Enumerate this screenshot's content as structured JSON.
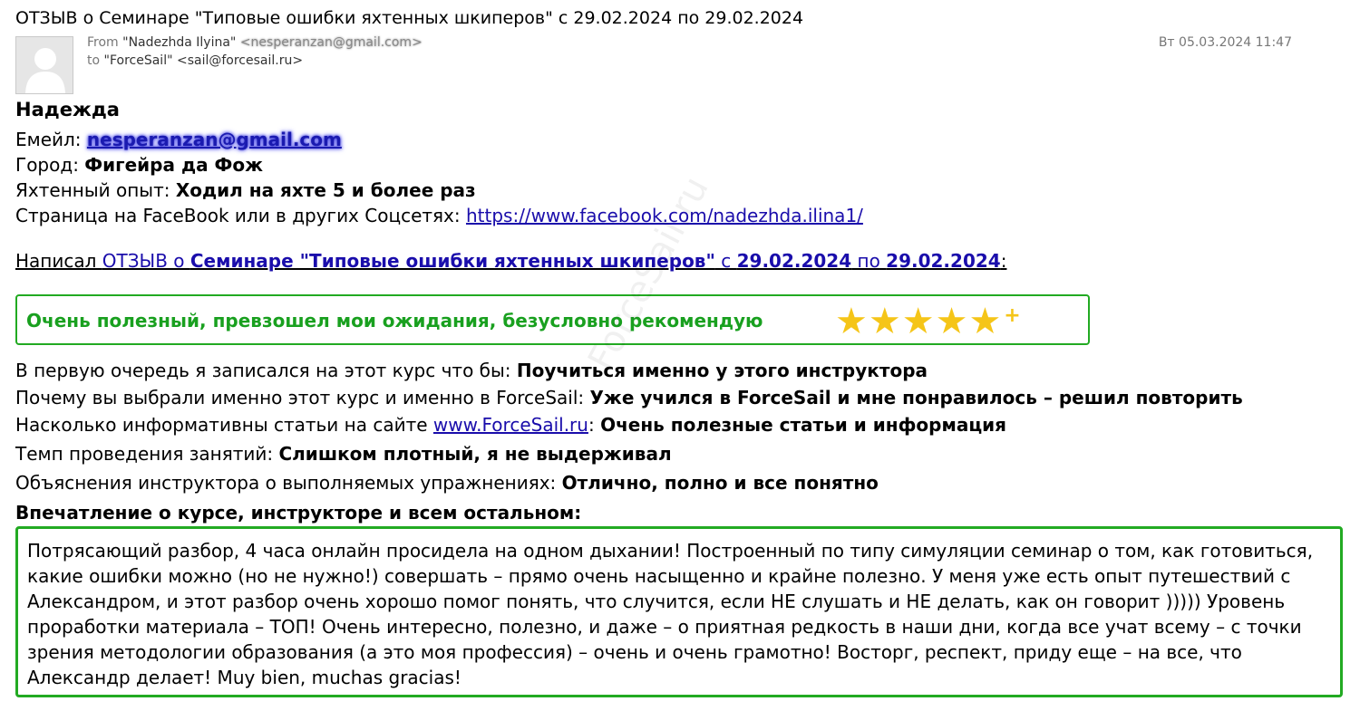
{
  "subject": "ОТЗЫВ о Семинаре \"Типовые ошибки яхтенных шкиперов\" с 29.02.2024 по 29.02.2024",
  "header": {
    "from_label": "From",
    "from_name": "\"Nadezhda Ilyina\"",
    "from_email": "<nesperanzan@gmail.com>",
    "to_label": "to",
    "to_value": "\"ForceSail\" <sail@forcesail.ru>",
    "date": "Вт 05.03.2024 11:47"
  },
  "body": {
    "name": "Надежда",
    "email_label": "Емейл: ",
    "email_value": "nesperanzan@gmail.com",
    "city_label": "Город: ",
    "city_value": "Фигейра да Фож",
    "experience_label": "Яхтенный опыт: ",
    "experience_value": "Ходил на яхте 5 и более раз",
    "facebook_label": "Страница на FaceBook или в других Соцсетях: ",
    "facebook_url": "https://www.facebook.com/nadezhda.ilina1/",
    "wrote_prefix": "Написал ",
    "wrote_review": "ОТЗЫВ о ",
    "wrote_course": "Семинаре \"Типовые ошибки яхтенных шкиперов\"",
    "wrote_from": " с ",
    "wrote_date_from": "29.02.2024",
    "wrote_to": " по ",
    "wrote_date_to": "29.02.2024",
    "wrote_colon": ":",
    "rating_text": "Очень полезный, превзошел мои ожидания, безусловно рекомендую",
    "rating_stars": 5,
    "rating_plus": "+",
    "q1_label": "В первую очередь я записался на этот курс что бы: ",
    "q1_value": "Поучиться именно у этого инструктора",
    "q2_label": "Почему вы выбрали именно этот курс и именно в ForceSail: ",
    "q2_value": "Уже учился в ForceSail и мне понравилось – решил повторить",
    "q3_label": "Насколько информативны статьи на сайте ",
    "q3_link": "www.ForceSail.ru",
    "q3_colon": ": ",
    "q3_value": "Очень полезные статьи и информация",
    "q4_label": "Темп проведения занятий: ",
    "q4_value": "Слишком плотный, я не выдерживал",
    "q5_label": "Объяснения инструктора о выполняемых упражнениях: ",
    "q5_value": "Отлично, полно и все понятно",
    "impression_title": "Впечатление о курсе, инструкторе и всем остальном:",
    "impression_text": "Потрясающий разбор, 4 часа онлайн просидела на одном дыхании! Построенный по типу симуляции семинар о том, как готовиться, какие ошибки можно (но не нужно!) совершать – прямо очень насыщенно и крайне полезно. У меня уже есть опыт путешествий с Александром, и этот разбор очень хорошо помог понять, что случится, если НЕ слушать и НЕ делать, как он говорит ))))) Уровень проработки материала – ТОП! Очень интересно, полезно, и даже – о приятная редкость в наши дни, когда все учат всему – с точки зрения методологии образования (а это моя профессия) – очень и очень грамотно! Восторг, респект, приду еще – на все, что Александр делает! Muy bien, muchas gracias!"
  },
  "watermark": "ForceSail.ru",
  "colors": {
    "accent_green": "#22aa22",
    "link_blue": "#1a0dab",
    "star_gold": "#f5c518"
  }
}
